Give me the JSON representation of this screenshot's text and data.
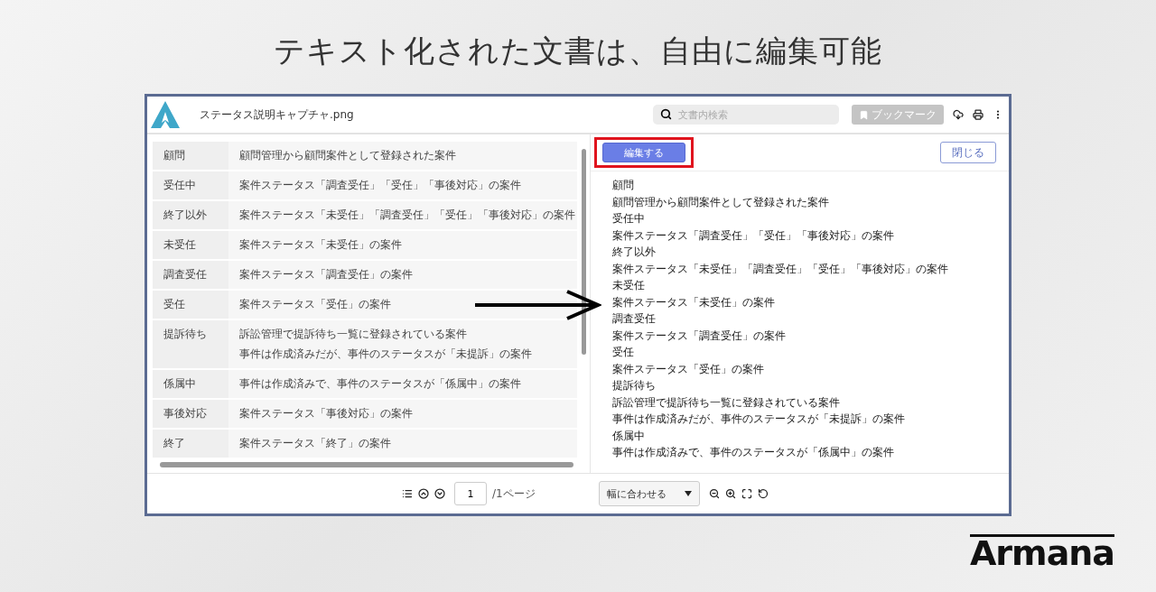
{
  "headline": "テキスト化された文書は、自由に編集可能",
  "viewer": {
    "file_name": "ステータス説明キャプチャ.png",
    "search": {
      "placeholder": "文書内検索"
    },
    "bookmark_button": {
      "label": "ブックマーク",
      "disabled": true
    },
    "table_rows": [
      {
        "status": "顧問",
        "description": [
          "顧問管理から顧問案件として登録された案件"
        ]
      },
      {
        "status": "受任中",
        "description": [
          "案件ステータス「調査受任」「受任」「事後対応」の案件"
        ]
      },
      {
        "status": "終了以外",
        "description": [
          "案件ステータス「未受任」「調査受任」「受任」「事後対応」の案件"
        ]
      },
      {
        "status": "未受任",
        "description": [
          "案件ステータス「未受任」の案件"
        ]
      },
      {
        "status": "調査受任",
        "description": [
          "案件ステータス「調査受任」の案件"
        ]
      },
      {
        "status": "受任",
        "description": [
          "案件ステータス「受任」の案件"
        ]
      },
      {
        "status": "提訴待ち",
        "description": [
          "訴訟管理で提訴待ち一覧に登録されている案件",
          "事件は作成済みだが、事件のステータスが「未提訴」の案件"
        ]
      },
      {
        "status": "係属中",
        "description": [
          "事件は作成済みで、事件のステータスが「係属中」の案件"
        ]
      },
      {
        "status": "事後対応",
        "description": [
          "案件ステータス「事後対応」の案件"
        ]
      },
      {
        "status": "終了",
        "description": [
          "案件ステータス「終了」の案件"
        ]
      }
    ],
    "edit_button": {
      "label": "編集する",
      "highlighted": true
    },
    "close_button": {
      "label": "閉じる"
    },
    "text_lines": [
      "顧問",
      "顧問管理から顧問案件として登録された案件",
      "受任中",
      "案件ステータス「調査受任」「受任」「事後対応」の案件",
      "終了以外",
      "案件ステータス「未受任」「調査受任」「受任」「事後対応」の案件",
      "未受任",
      "案件ステータス「未受任」の案件",
      "調査受任",
      "案件ステータス「調査受任」の案件",
      "受任",
      "案件ステータス「受任」の案件",
      "提訴待ち",
      "訴訟管理で提訴待ち一覧に登録されている案件",
      "事件は作成済みだが、事件のステータスが「未提訴」の案件",
      "係属中",
      "事件は作成済みで、事件のステータスが「係属中」の案件"
    ],
    "page_input": {
      "value": "1"
    },
    "page_total": "/1ページ",
    "zoom_select": {
      "value": "幅に合わせる"
    }
  },
  "brand": "Armana"
}
